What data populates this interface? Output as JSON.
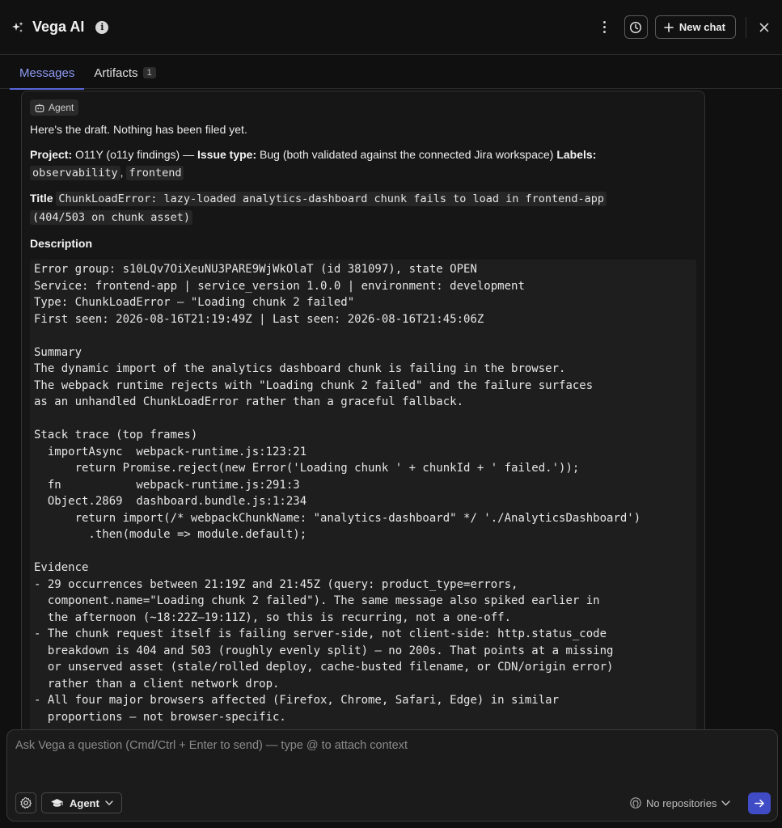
{
  "header": {
    "title": "Vega AI",
    "info_glyph": "i",
    "new_chat_label": "New chat",
    "icons": [
      "sparkle-icon",
      "info-icon",
      "kebab-icon",
      "history-icon",
      "plus-icon",
      "close-icon"
    ]
  },
  "tabs": [
    {
      "label": "Messages",
      "active": true
    },
    {
      "label": "Artifacts",
      "count": "1",
      "active": false
    }
  ],
  "message": {
    "badge": "Agent",
    "intro": "Here's the draft. Nothing has been filed yet.",
    "meta": {
      "project_label": "Project:",
      "project_value": " O11Y (o11y findings) — ",
      "issue_type_label": "Issue type:",
      "issue_type_value": " Bug (both validated against the connected Jira workspace) ",
      "labels_label": "Labels:",
      "label_1": "observability",
      "separator": ", ",
      "label_2": "frontend"
    },
    "title_label": "Title",
    "title_value": "ChunkLoadError: lazy-loaded analytics-dashboard chunk fails to load in frontend-app",
    "title_value_2": "(404/503 on chunk asset)",
    "description_label": "Description",
    "description_lines": [
      "Error group: s10LQv7OiXeuNU3PARE9WjWkOlaT (id 381097), state OPEN",
      "Service: frontend-app | service_version 1.0.0 | environment: development",
      "Type: ChunkLoadError — \"Loading chunk 2 failed\"",
      "First seen: 2026-08-16T21:19:49Z | Last seen: 2026-08-16T21:45:06Z",
      "",
      "Summary",
      "The dynamic import of the analytics dashboard chunk is failing in the browser.",
      "The webpack runtime rejects with \"Loading chunk 2 failed\" and the failure surfaces",
      "as an unhandled ChunkLoadError rather than a graceful fallback.",
      "",
      "Stack trace (top frames)",
      "  importAsync  webpack-runtime.js:123:21",
      "      return Promise.reject(new Error('Loading chunk ' + chunkId + ' failed.'));",
      "  fn           webpack-runtime.js:291:3",
      "  Object.2869  dashboard.bundle.js:1:234",
      "      return import(/* webpackChunkName: \"analytics-dashboard\" */ './AnalyticsDashboard')",
      "        .then(module => module.default);",
      "",
      "Evidence",
      "- 29 occurrences between 21:19Z and 21:45Z (query: product_type=errors,",
      "  component.name=\"Loading chunk 2 failed\"). The same message also spiked earlier in",
      "  the afternoon (~18:22Z–19:11Z), so this is recurring, not a one-off.",
      "- The chunk request itself is failing server-side, not client-side: http.status_code",
      "  breakdown is 404 and 503 (roughly evenly split) — no 200s. That points at a missing",
      "  or unserved asset (stale/rolled deploy, cache-busted filename, or CDN/origin error)",
      "  rather than a client network drop.",
      "- All four major browsers affected (Firefox, Chrome, Safari, Edge) in similar",
      "  proportions — not browser-specific."
    ]
  },
  "composer": {
    "placeholder": "Ask Vega a question (Cmd/Ctrl + Enter to send) — type @ to attach context",
    "mode_label": "Agent",
    "repo_label": "No repositories",
    "icons": [
      "gear-icon",
      "graduation-cap-icon",
      "chevron-down-icon",
      "github-icon",
      "arrow-right-icon"
    ]
  },
  "colors": {
    "accent": "#5865d8",
    "active_tab_text": "#8d9bf4",
    "send_button": "#3f4cc6",
    "background": "#101010"
  }
}
